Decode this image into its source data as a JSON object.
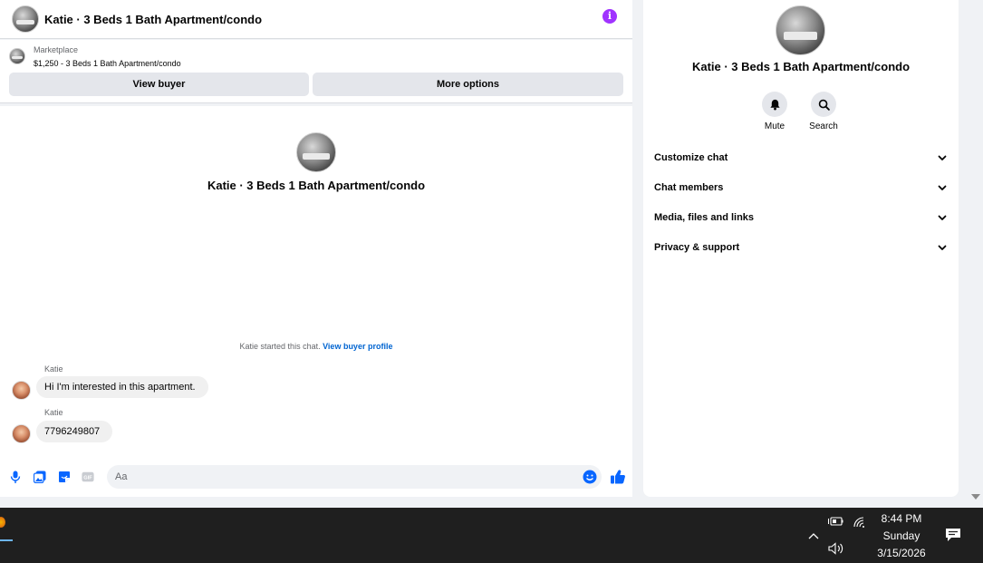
{
  "header": {
    "title": "Katie · 3 Beds 1 Bath Apartment/condo"
  },
  "marketplace": {
    "label": "Marketplace",
    "item": "$1,250 - 3 Beds 1 Bath Apartment/condo",
    "view_buyer_label": "View buyer",
    "more_options_label": "More options"
  },
  "conversation": {
    "title": "Katie · 3 Beds 1 Bath Apartment/condo",
    "started_text": "Katie started this chat.",
    "view_buyer_profile_link": "View buyer profile",
    "messages": [
      {
        "sender": "Katie",
        "text": "Hi I'm interested in this apartment."
      },
      {
        "sender": "Katie",
        "text": "7796249807"
      }
    ]
  },
  "composer": {
    "placeholder": "Aa"
  },
  "info_panel": {
    "title": "Katie · 3 Beds 1 Bath Apartment/condo",
    "mute_label": "Mute",
    "search_label": "Search",
    "sections": [
      {
        "label": "Customize chat"
      },
      {
        "label": "Chat members"
      },
      {
        "label": "Media, files and links"
      },
      {
        "label": "Privacy & support"
      }
    ]
  },
  "taskbar": {
    "time": "8:44 PM",
    "day": "Sunday",
    "date": "3/15/2026"
  },
  "colors": {
    "accent_blue": "#0866ff",
    "info_purple": "#a033ff",
    "link_blue": "#0064d1",
    "taskbar_bg": "#1f1f1f"
  },
  "icons": [
    "info-icon",
    "mic-icon",
    "image-icon",
    "sticker-icon",
    "gif-icon",
    "emoji-icon",
    "like-icon",
    "bell-icon",
    "search-icon",
    "chevron-down-icon",
    "battery-icon",
    "wifi-icon",
    "speaker-icon",
    "notification-icon"
  ]
}
